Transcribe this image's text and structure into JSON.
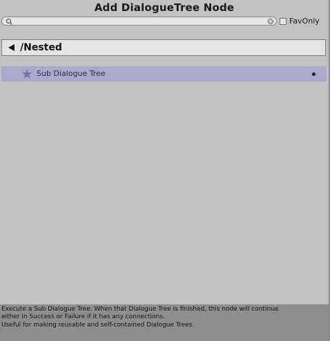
{
  "window": {
    "title": "Add DialogueTree Node"
  },
  "search": {
    "value": "",
    "placeholder": ""
  },
  "fav_only": {
    "label": "FavOnly",
    "checked": false
  },
  "breadcrumb": {
    "back_icon": "left-triangle-icon",
    "path": "/Nested"
  },
  "items": [
    {
      "icon": "star-icon",
      "label": "Sub Dialogue Tree",
      "selected": true
    }
  ],
  "footer": {
    "line1": "Execute a Sub Dialogue Tree. When that Dialogue Tree is finished, this node will continue",
    "line2": "either in Success or Failure if it has any connections.",
    "line3": "Useful for making reusable and self-contained Dialogue Trees."
  },
  "colors": {
    "background": "#c2c2c2",
    "selection": "#a9a9cd",
    "footer": "#8e8e8e"
  }
}
